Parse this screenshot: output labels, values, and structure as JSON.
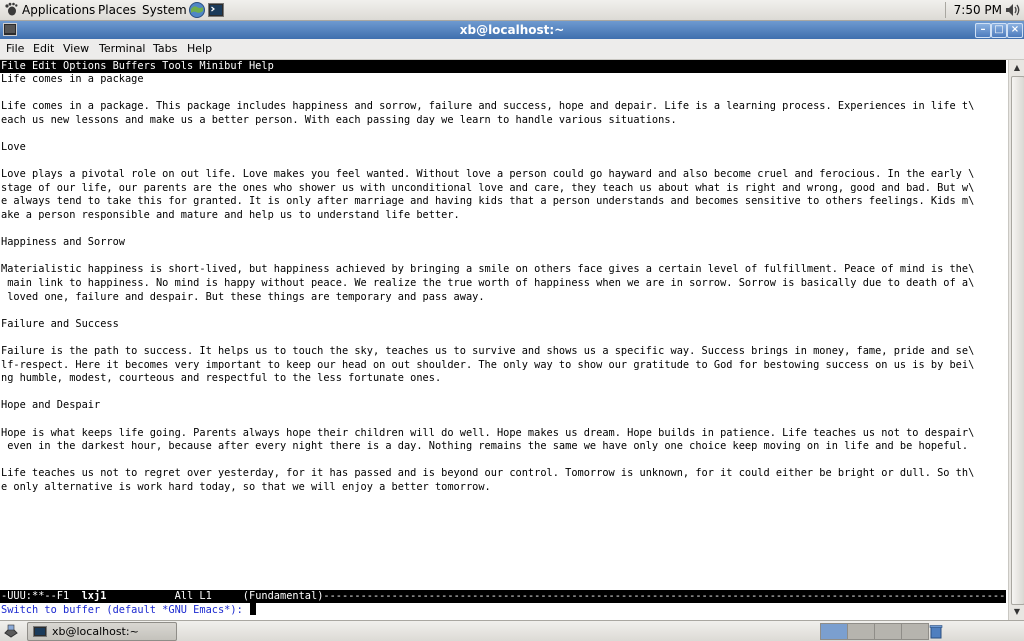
{
  "top_panel": {
    "applications": "Applications",
    "places": "Places",
    "system": "System",
    "clock": "7:50 PM"
  },
  "window": {
    "title": "xb@localhost:~"
  },
  "terminal_menu": [
    "File",
    "Edit",
    "View",
    "Terminal",
    "Tabs",
    "Help"
  ],
  "emacs": {
    "menubar": "File Edit Options Buffers Tools Minibuf Help",
    "lines": [
      "Life comes in a package",
      "",
      "Life comes in a package. This package includes happiness and sorrow, failure and success, hope and depair. Life is a learning process. Experiences in life t\\",
      "each us new lessons and make us a better person. With each passing day we learn to handle various situations.",
      "",
      "Love",
      "",
      "Love plays a pivotal role on out life. Love makes you feel wanted. Without love a person could go hayward and also become cruel and ferocious. In the early \\",
      "stage of our life, our parents are the ones who shower us with unconditional love and care, they teach us about what is right and wrong, good and bad. But w\\",
      "e always tend to take this for granted. It is only after marriage and having kids that a person understands and becomes sensitive to others feelings. Kids m\\",
      "ake a person responsible and mature and help us to understand life better.",
      "",
      "Happiness and Sorrow",
      "",
      "Materialistic happiness is short-lived, but happiness achieved by bringing a smile on others face gives a certain level of fulfillment. Peace of mind is the\\",
      " main link to happiness. No mind is happy without peace. We realize the true worth of happiness when we are in sorrow. Sorrow is basically due to death of a\\",
      " loved one, failure and despair. But these things are temporary and pass away.",
      "",
      "Failure and Success",
      "",
      "Failure is the path to success. It helps us to touch the sky, teaches us to survive and shows us a specific way. Success brings in money, fame, pride and se\\",
      "lf-respect. Here it becomes very important to keep our head on out shoulder. The only way to show our gratitude to God for bestowing success on us is by bei\\",
      "ng humble, modest, courteous and respectful to the less fortunate ones.",
      "",
      "Hope and Despair",
      "",
      "Hope is what keeps life going. Parents always hope their children will do well. Hope makes us dream. Hope builds in patience. Life teaches us not to despair\\",
      " even in the darkest hour, because after every night there is a day. Nothing remains the same we have only one choice keep moving on in life and be hopeful.",
      "",
      "Life teaches us not to regret over yesterday, for it has passed and is beyond our control. Tomorrow is unknown, for it could either be bright or dull. So th\\",
      "e only alternative is work hard today, so that we will enjoy a better tomorrow."
    ],
    "modeline": {
      "status": "-UUU:**--F1  ",
      "buffer": "lxj1",
      "position": "           All L1     ",
      "mode": "(Fundamental)",
      "fill": "------------------------------------------------------------------------------------------------------------------------------"
    },
    "minibuffer": "Switch to buffer (default *GNU Emacs*): "
  },
  "bottom_panel": {
    "task_label": "xb@localhost:~"
  },
  "colors": {
    "titlebar": "#3f6fae",
    "minibuffer_text": "#1c2ad0"
  }
}
